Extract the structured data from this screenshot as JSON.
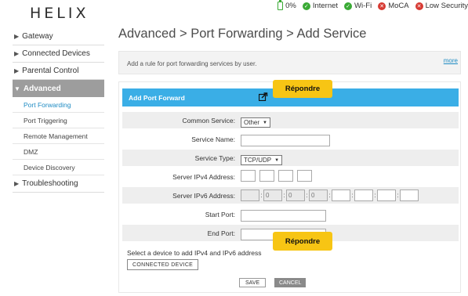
{
  "header": {
    "logo": "HELIX",
    "battery": "0%",
    "status": [
      {
        "label": "Internet",
        "state": "ok",
        "icon": "check-icon"
      },
      {
        "label": "Wi-Fi",
        "state": "ok",
        "icon": "check-icon"
      },
      {
        "label": "MoCA",
        "state": "bad",
        "icon": "cross-icon"
      },
      {
        "label": "Low Security",
        "state": "bad",
        "icon": "cross-icon"
      }
    ]
  },
  "sidebar": {
    "items": [
      {
        "label": "Gateway"
      },
      {
        "label": "Connected Devices"
      },
      {
        "label": "Parental Control"
      },
      {
        "label": "Advanced"
      },
      {
        "label": "Troubleshooting"
      }
    ],
    "sub_items": [
      {
        "label": "Port Forwarding"
      },
      {
        "label": "Port Triggering"
      },
      {
        "label": "Remote Management"
      },
      {
        "label": "DMZ"
      },
      {
        "label": "Device Discovery"
      }
    ]
  },
  "main": {
    "title": "Advanced > Port Forwarding > Add Service",
    "info": "Add a rule for port forwarding services by user.",
    "more_link": "more",
    "panel_title": "Add Port Forward",
    "form": {
      "common_service_label": "Common Service:",
      "common_service_value": "Other",
      "service_name_label": "Service Name:",
      "service_type_label": "Service Type:",
      "service_type_value": "TCP/UDP",
      "ipv4_label": "Server IPv4 Address:",
      "ipv6_label": "Server IPv6 Address:",
      "ipv6_prefix": [
        "0",
        "0",
        "0"
      ],
      "start_port_label": "Start Port:",
      "end_port_label": "End Port:"
    },
    "device_hint": "Select a device to add IPv4 and IPv6 address",
    "device_button": "CONNECTED DEVICE",
    "save_button": "SAVE",
    "cancel_button": "CANCEL"
  },
  "overlay": {
    "respond_label": "Répondre"
  },
  "colors": {
    "accent": "#3aaee6",
    "link": "#1e8bc3",
    "ok": "#3aaa35",
    "bad": "#d73a33",
    "highlight": "#f7c514"
  }
}
